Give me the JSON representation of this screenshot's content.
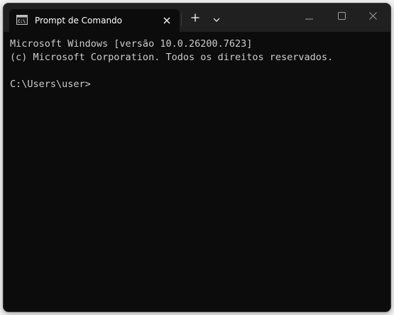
{
  "window": {
    "tab_title": "Prompt de Comando",
    "tab_icon": "cmd-icon",
    "new_tab_icon": "plus-icon",
    "dropdown_icon": "chevron-down-icon",
    "controls": [
      "minimize-icon",
      "maximize-icon",
      "close-icon"
    ]
  },
  "terminal": {
    "lines": [
      "Microsoft Windows [versão 10.0.26200.7623]",
      "(c) Microsoft Corporation. Todos os direitos reservados.",
      ""
    ],
    "prompt": "C:\\Users\\user>"
  },
  "colors": {
    "background": "#0c0c0c",
    "titlebar": "#202020",
    "text": "#cccccc"
  }
}
